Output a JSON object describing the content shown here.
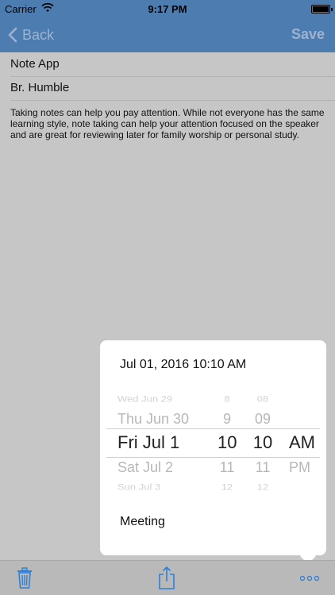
{
  "status_bar": {
    "carrier": "Carrier",
    "time": "9:17 PM"
  },
  "nav": {
    "back_label": "Back",
    "save_label": "Save"
  },
  "note": {
    "title": "Note App",
    "speaker": "Br. Humble",
    "body": "Taking notes can help you pay attention. While not everyone has the same learning style, note taking can help your attention focused on the speaker and are great for reviewing later for family worship or personal study."
  },
  "popover": {
    "selected_datetime": "Jul 01, 2016 10:10 AM",
    "category": "Meeting",
    "picker": {
      "dates": [
        "Wed Jun 29",
        "Thu Jun 30",
        "Fri Jul 1",
        "Sat Jul 2",
        "Sun Jul 3"
      ],
      "hours": [
        "8",
        "9",
        "10",
        "11",
        "12"
      ],
      "minutes": [
        "08",
        "09",
        "10",
        "11",
        "12"
      ],
      "ampm": [
        "",
        "",
        "AM",
        "PM",
        ""
      ]
    }
  },
  "toolbar": {
    "icons": [
      "trash-icon",
      "share-icon",
      "more-icon"
    ]
  },
  "colors": {
    "nav_bar": "#4d7cb0",
    "nav_button": "#9db3cf",
    "tint": "#2f7fd6",
    "background": "#c6c6c6"
  }
}
